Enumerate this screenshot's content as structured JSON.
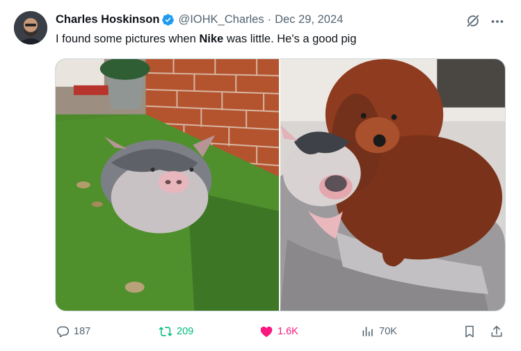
{
  "tweet": {
    "author_name": "Charles Hoskinson",
    "handle": "@IOHK_Charles",
    "separator": "·",
    "date": "Dec 29, 2024",
    "text_before": "I found some pictures when ",
    "text_bold": "Nike",
    "text_after": " was little. He's a good pig"
  },
  "media": {
    "photos": [
      {
        "subject": "pig-in-grass-photo"
      },
      {
        "subject": "pig-with-dog-photo"
      }
    ]
  },
  "actions": {
    "replies": "187",
    "reposts": "209",
    "likes": "1.6K",
    "views": "70K"
  },
  "colors": {
    "verified": "#1d9bf0",
    "repost": "#00ba7c",
    "like": "#f91880",
    "muted": "#536471"
  },
  "icons": [
    "verified-badge-icon",
    "grok-icon",
    "more-icon",
    "reply-icon",
    "repost-icon",
    "like-icon",
    "views-icon",
    "bookmark-icon",
    "share-icon"
  ]
}
